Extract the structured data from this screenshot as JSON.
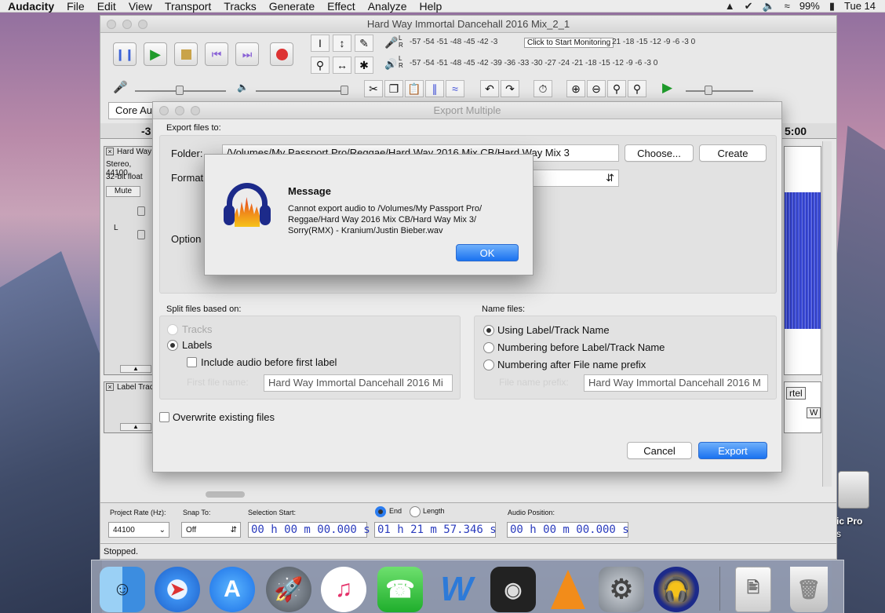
{
  "menubar": {
    "app": "Audacity",
    "items": [
      "File",
      "Edit",
      "View",
      "Transport",
      "Tracks",
      "Generate",
      "Effect",
      "Analyze",
      "Help"
    ],
    "battery": "99%",
    "clock": "Tue 14"
  },
  "window": {
    "title": "Hard Way Immortal Dancehall 2016 Mix_2_1",
    "meter_scale": "-57 -54 -51 -48 -45 -42 -39 -36 -33 -30 -27 -24 -21 -18 -15 -12 -9 -6 -3 0",
    "meter_scale_short": "-57 -54 -51 -48 -45 -42 -3",
    "meter_scale_tail": "21 -18 -15 -12 -9 -6 -3 0",
    "monitor_label": "Click to Start Monitoring",
    "device_label": "Core Au",
    "ruler_left": "-3",
    "ruler_right": "5:00",
    "track1": {
      "name": "Hard Way",
      "info1": "Stereo, 44100",
      "info2": "32-bit float",
      "mute": "Mute",
      "left": "L"
    },
    "track2": {
      "name": "Label Track",
      "label1": "rtel",
      "label2": "W"
    },
    "bottom": {
      "project_rate_label": "Project Rate (Hz):",
      "project_rate_value": "44100",
      "snap_label": "Snap To:",
      "snap_value": "Off",
      "selection_start_label": "Selection Start:",
      "end_label": "End",
      "length_label": "Length",
      "audio_position_label": "Audio Position:",
      "selection_start": "00 h 00 m 00.000 s",
      "selection_end": "01 h 21 m 57.346 s",
      "audio_position": "00 h 00 m 00.000 s"
    },
    "status": "Stopped."
  },
  "export_dialog": {
    "title": "Export Multiple",
    "export_to_label": "Export files to:",
    "folder_label": "Folder:",
    "folder_value": "/Volumes/My Passport Pro/Reggae/Hard Way 2016 Mix CB/Hard Way Mix 3",
    "choose_button": "Choose...",
    "create_button": "Create",
    "format_label": "Format",
    "options_label": "Option",
    "split_label": "Split files based on:",
    "tracks_option": "Tracks",
    "labels_option": "Labels",
    "include_audio": "Include audio before first label",
    "first_file_name_label": "First file name:",
    "first_file_name_value": "Hard Way Immortal Dancehall 2016 Mi",
    "name_files_label": "Name files:",
    "using_label": "Using Label/Track Name",
    "numbering_before": "Numbering before Label/Track Name",
    "numbering_after": "Numbering after File name prefix",
    "file_prefix_label": "File name prefix:",
    "file_prefix_value": "Hard Way Immortal Dancehall 2016 M",
    "overwrite": "Overwrite existing files",
    "cancel_button": "Cancel",
    "export_button": "Export"
  },
  "message": {
    "title": "Message",
    "body_line1": "Cannot export audio to /Volumes/My Passport Pro/",
    "body_line2": "Reggae/Hard Way 2016 Mix CB/Hard Way Mix 3/",
    "body_line3": "Sorry(RMX) - Kranium/Justin Bieber.wav",
    "ok_button": "OK"
  },
  "desktop": {
    "drive_label1": "ic Pro",
    "drive_label2": "s"
  }
}
